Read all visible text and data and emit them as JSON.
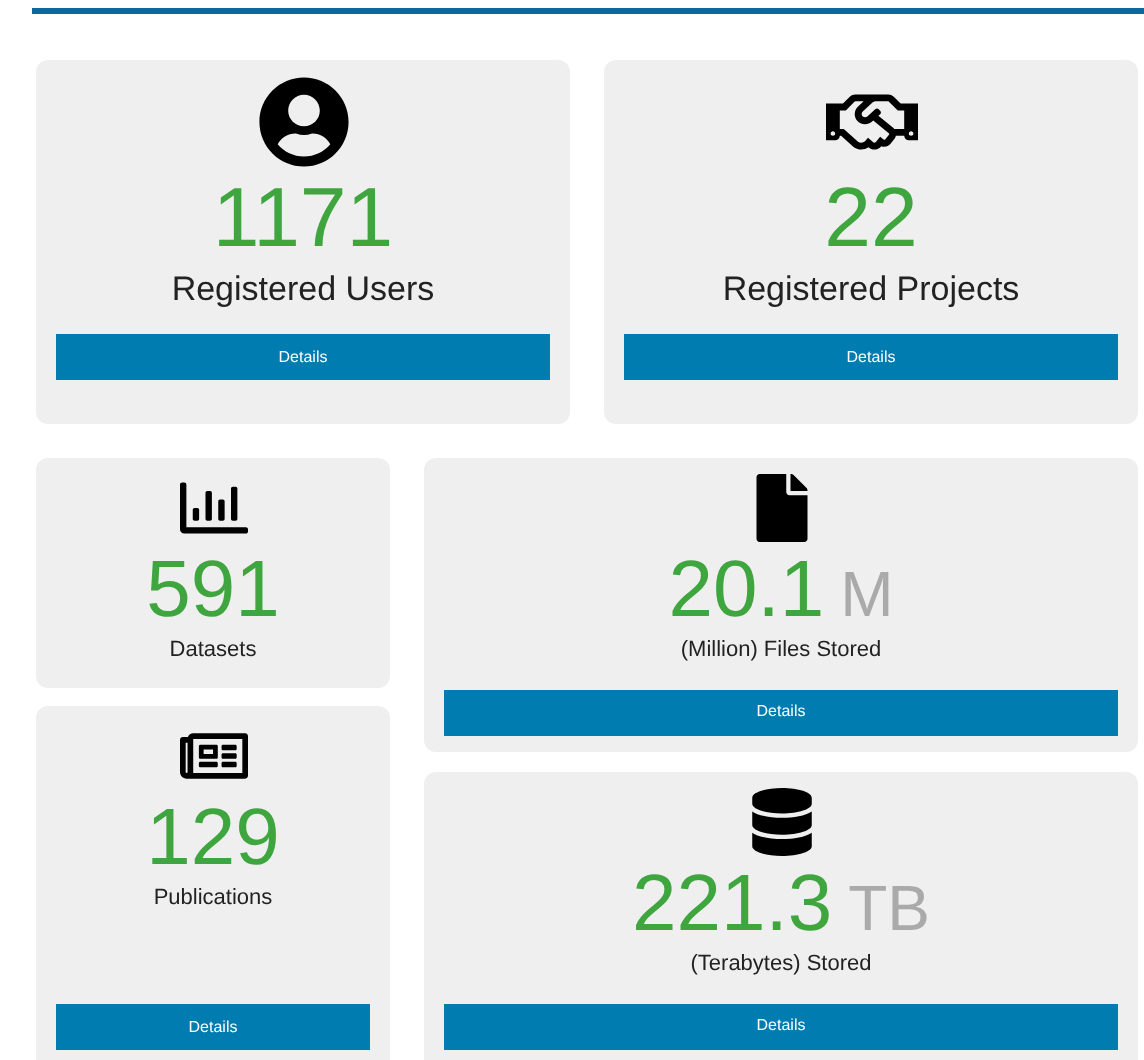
{
  "top_cards": [
    {
      "kind": "user",
      "value": "1171",
      "label": "Registered Users",
      "button": "Details"
    },
    {
      "kind": "handshake",
      "value": "22",
      "label": "Registered Projects",
      "button": "Details"
    }
  ],
  "left_cards": [
    {
      "kind": "chart",
      "value": "591",
      "label": "Datasets"
    },
    {
      "kind": "newspaper",
      "value": "129",
      "label": "Publications",
      "button": "Details"
    }
  ],
  "right_cards": [
    {
      "kind": "file",
      "value": "20.1",
      "unit": "M",
      "label": "(Million) Files Stored",
      "button": "Details"
    },
    {
      "kind": "database",
      "value": "221.3",
      "unit": "TB",
      "label": "(Terabytes) Stored",
      "button": "Details"
    }
  ]
}
